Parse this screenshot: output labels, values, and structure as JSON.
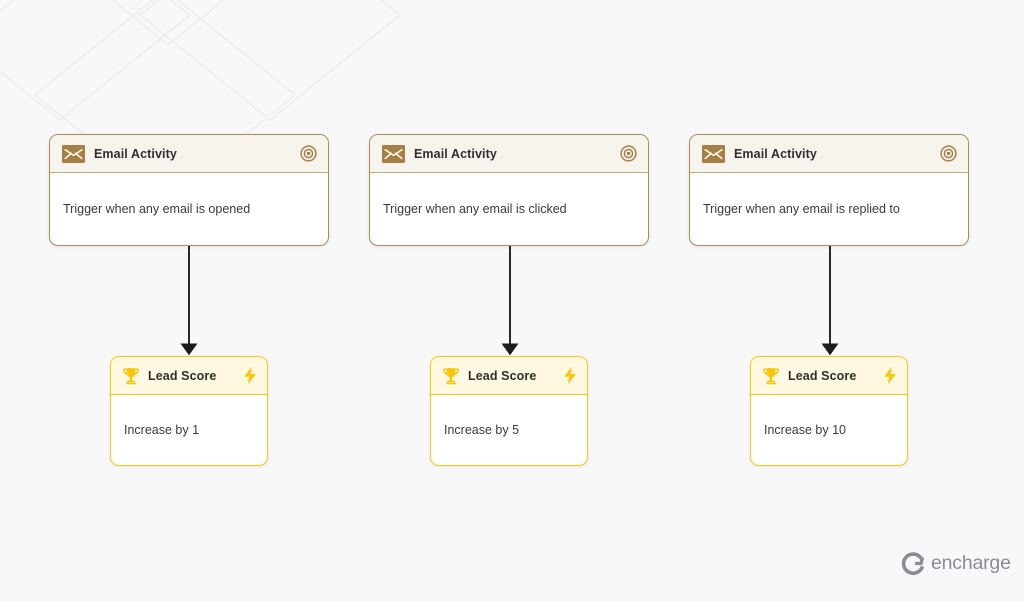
{
  "canvas": {
    "background_color": "#f8f8fa",
    "pattern_name": "isometric-diamond-watermark"
  },
  "colors": {
    "trigger_border": "#b08a54",
    "trigger_header_bg": "#f7f3ed",
    "trigger_icon_bg": "#a87f43",
    "action_border": "#efc81a",
    "action_header_bg": "#fdf8df",
    "action_icon": "#f2c811",
    "connector": "#1c1c1c",
    "title_text": "#2f2f33",
    "body_text": "#3a3a3e",
    "logo": "#8c8c92"
  },
  "flows": [
    {
      "trigger": {
        "title": "Email Activity",
        "body": "Trigger when any email is opened",
        "left_icon": "envelope-icon",
        "right_icon": "target-icon"
      },
      "action": {
        "title": "Lead Score",
        "body": "Increase by 1",
        "left_icon": "trophy-icon",
        "right_icon": "bolt-icon"
      }
    },
    {
      "trigger": {
        "title": "Email Activity",
        "body": "Trigger when any email is clicked",
        "left_icon": "envelope-icon",
        "right_icon": "target-icon"
      },
      "action": {
        "title": "Lead Score",
        "body": "Increase by 5",
        "left_icon": "trophy-icon",
        "right_icon": "bolt-icon"
      }
    },
    {
      "trigger": {
        "title": "Email Activity",
        "body": "Trigger when any email is replied to",
        "left_icon": "envelope-icon",
        "right_icon": "target-icon"
      },
      "action": {
        "title": "Lead Score",
        "body": "Increase by 10",
        "left_icon": "trophy-icon",
        "right_icon": "bolt-icon"
      }
    }
  ],
  "logo": {
    "text": "encharge",
    "mark": "encharge-c-mark-icon"
  }
}
